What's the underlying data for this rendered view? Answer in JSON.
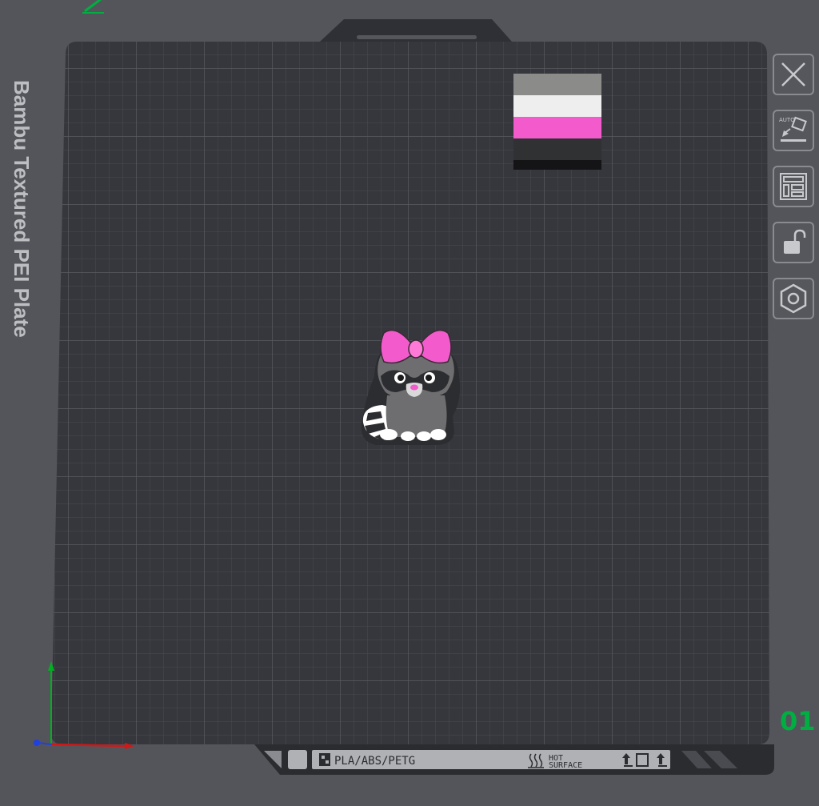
{
  "plate": {
    "name": "Bambu Textured PEI Plate",
    "number": "01",
    "filament_label": "PLA/ABS/PETG",
    "hot_label_line1": "HOT",
    "hot_label_line2": "SURFACE"
  },
  "toolbar": {
    "items": [
      {
        "icon": "close-icon"
      },
      {
        "icon": "auto-orient-icon",
        "badge": "AUTO"
      },
      {
        "icon": "arrange-icon"
      },
      {
        "icon": "lock-icon"
      },
      {
        "icon": "plate-settings-icon"
      }
    ]
  },
  "objects": {
    "color_cube": {
      "colors": [
        "#8b8c89",
        "#eeeeee",
        "#f35bcd",
        "#303133"
      ]
    },
    "raccoon": {
      "bow_color": "#f35bcd",
      "body_color": "#6e6e70"
    }
  },
  "colors": {
    "accent": "#00ae42",
    "plate": "#36373c",
    "background": "#54555a"
  }
}
